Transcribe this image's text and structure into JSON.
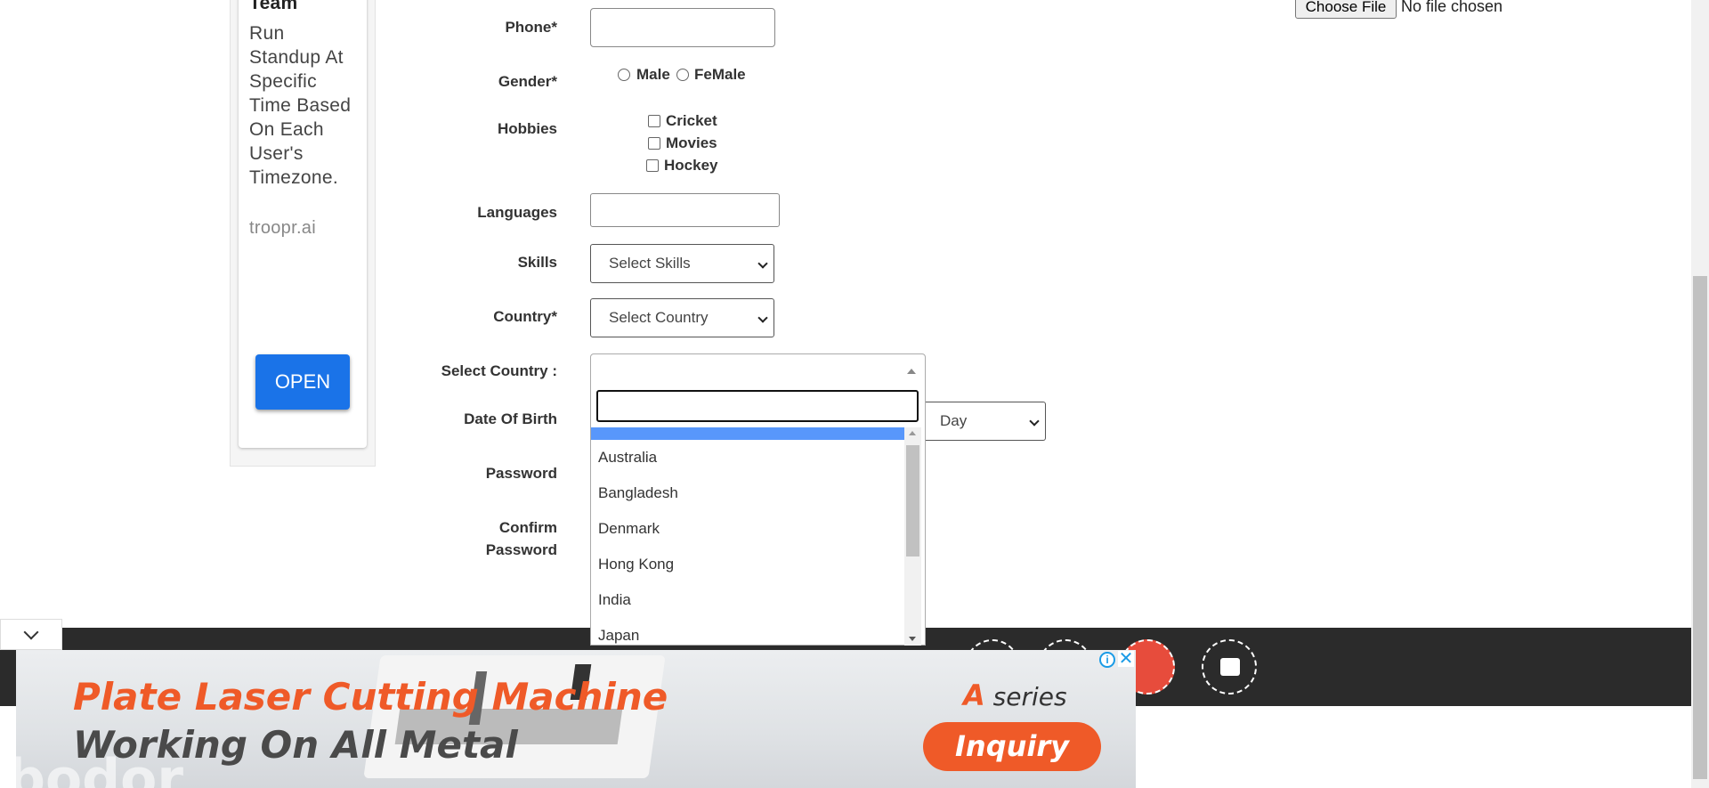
{
  "left_ad": {
    "heading_partial": "Team",
    "body_lines": [
      "Run",
      "Standup At",
      "Specific",
      "Time Based",
      "On Each",
      "User's",
      "Timezone."
    ],
    "domain": "troopr.ai",
    "open_button": "OPEN"
  },
  "file_upload": {
    "button": "Choose File",
    "status": "No file chosen"
  },
  "form": {
    "phone_label": "Phone*",
    "gender_label": "Gender*",
    "gender_options": [
      "Male",
      "FeMale"
    ],
    "hobbies_label": "Hobbies",
    "hobbies_options": [
      "Cricket",
      "Movies",
      "Hockey"
    ],
    "languages_label": "Languages",
    "skills_label": "Skills",
    "skills_value": "Select Skills",
    "country_label": "Country*",
    "country_value": "Select Country",
    "select_country_label": "Select Country :",
    "dob_label": "Date Of Birth",
    "dob_day_value": "Day",
    "password_label": "Password",
    "confirm_password_label_1": "Confirm",
    "confirm_password_label_2": "Password"
  },
  "dropdown": {
    "items": [
      "Australia",
      "Bangladesh",
      "Denmark",
      "Hong Kong",
      "India",
      "Japan"
    ]
  },
  "bottom_ad": {
    "line1": "Plate Laser Cutting Machine",
    "line2": "Working On All Metal",
    "series_a": "A",
    "series_word": "series",
    "cta": "Inquiry",
    "brand_partial": "bodor"
  },
  "colors": {
    "accent_blue": "#1a73e8",
    "ad_orange": "#ef5a28",
    "footer_bg": "#2b2b2b",
    "highlight": "#5897fb"
  }
}
